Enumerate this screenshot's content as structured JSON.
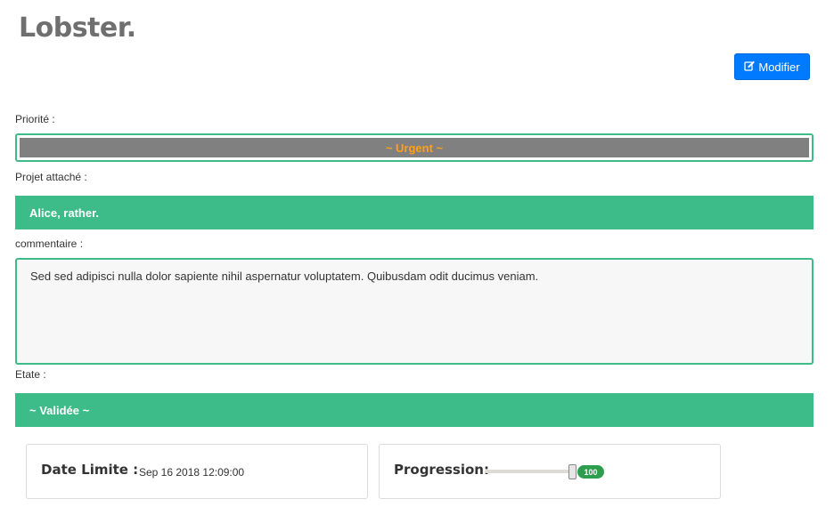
{
  "header": {
    "title": "Lobster.",
    "edit_button_label": "Modifier",
    "edit_icon": "edit-icon"
  },
  "fields": {
    "priority_label": "Priorité :",
    "priority_value": "~ Urgent ~",
    "project_label": "Projet attaché :",
    "project_value": "Alice, rather.",
    "comment_label": "commentaire :",
    "comment_value": "Sed sed adipisci nulla dolor sapiente nihil aspernatur voluptatem. Quibusdam odit ducimus veniam.",
    "status_label": "Etate :",
    "status_value": "~ Validée ~"
  },
  "deadline": {
    "label": "Date Limite :",
    "value": "Sep 16 2018 12:09:00"
  },
  "progress": {
    "label": "Progression:",
    "value": 100,
    "value_text": "100"
  },
  "colors": {
    "primary_button": "#007bff",
    "accent_green": "#3dbc8a",
    "priority_text": "#ff9f1a",
    "priority_bar": "#808080",
    "badge_green": "#2e9e4e"
  }
}
